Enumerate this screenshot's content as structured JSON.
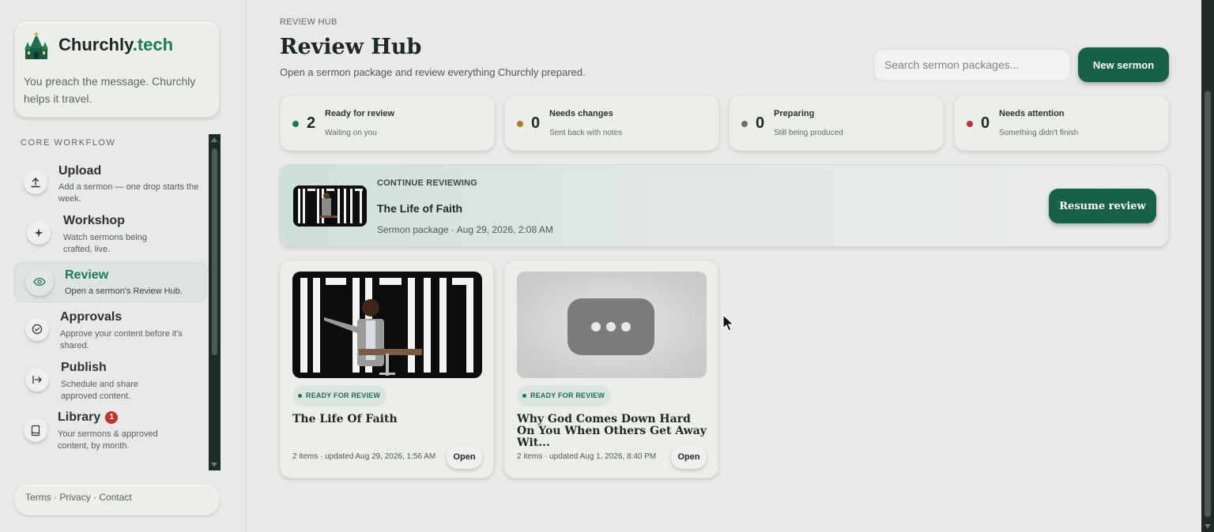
{
  "brand": {
    "name": "Churchly",
    "tld": ".tech",
    "tagline": "You preach the message. Churchly helps it travel."
  },
  "sidebar": {
    "section_label": "CORE WORKFLOW",
    "items": [
      {
        "label": "Upload",
        "description": "Add a sermon — one drop starts the week.",
        "icon": "upload-icon"
      },
      {
        "label": "Workshop",
        "description": "Watch sermons being crafted, live.",
        "icon": "sparkle-icon"
      },
      {
        "label": "Review",
        "description": "Open a sermon's Review Hub.",
        "icon": "eye-icon"
      },
      {
        "label": "Approvals",
        "description": "Approve your content before it's shared.",
        "icon": "check-circle-icon"
      },
      {
        "label": "Publish",
        "description": "Schedule and share approved content.",
        "icon": "arrow-right-bar-icon"
      },
      {
        "label": "Library",
        "description": "Your sermons & approved content, by month.",
        "icon": "book-icon",
        "badge": "1"
      }
    ],
    "footer": {
      "terms": "Terms",
      "privacy": "Privacy",
      "contact": "Contact",
      "separator": "·"
    }
  },
  "header": {
    "breadcrumb": "REVIEW HUB",
    "title": "Review Hub",
    "subtitle": "Open a sermon package and review everything Churchly prepared.",
    "search_placeholder": "Search sermon packages...",
    "new_button": "New sermon"
  },
  "stats": [
    {
      "count": "2",
      "label": "Ready for review",
      "sub": "Waiting on you",
      "color": "#1c7a5c"
    },
    {
      "count": "0",
      "label": "Needs changes",
      "sub": "Sent back with notes",
      "color": "#b07a24"
    },
    {
      "count": "0",
      "label": "Preparing",
      "sub": "Still being produced",
      "color": "#6b6f6d"
    },
    {
      "count": "0",
      "label": "Needs attention",
      "sub": "Something didn't finish",
      "color": "#c0342d"
    }
  ],
  "continue": {
    "kicker": "CONTINUE REVIEWING",
    "title": "The Life of Faith",
    "meta": "Sermon package · Aug 29, 2026, 2:08 AM",
    "button": "Resume review"
  },
  "packages": [
    {
      "status": "READY FOR REVIEW",
      "title": "The Life Of Faith",
      "meta": "2 items · updated Aug 29, 2026, 1:56 AM",
      "button": "Open"
    },
    {
      "status": "READY FOR REVIEW",
      "title": "Why God Comes Down Hard On You When Others Get Away Wit...",
      "meta": "2 items · updated Aug 1, 2026, 8:40 PM",
      "button": "Open"
    }
  ],
  "colors": {
    "accent": "#17614b",
    "brand_tld": "#1c7a5c",
    "badge": "#c0342d"
  }
}
